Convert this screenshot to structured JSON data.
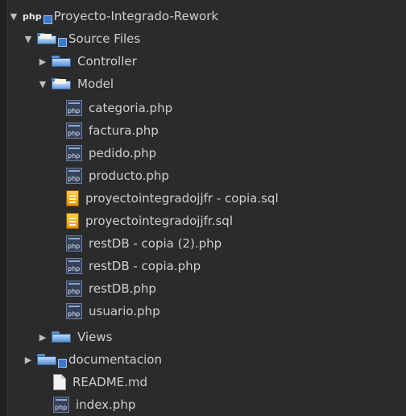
{
  "tree": {
    "project": {
      "name": "Proyecto-Integrado-Rework",
      "icon": "php-project-icon",
      "children": {
        "source_files": {
          "name": "Source Files",
          "icon": "source-folder-icon",
          "folders": {
            "controller": "Controller",
            "model": "Model",
            "views": "Views"
          },
          "model_files": [
            "categoria.php",
            "factura.php",
            "pedido.php",
            "producto.php",
            "proyectointegradojjfr - copia.sql",
            "proyectointegradojjfr.sql",
            "restDB - copia (2).php",
            "restDB - copia.php",
            "restDB.php",
            "usuario.php"
          ]
        },
        "documentacion": "documentacion",
        "readme": "README.md",
        "index": "index.php"
      }
    }
  },
  "colors": {
    "background": "#2b2b2b",
    "text": "#cfcfcf",
    "folder": "#5b8fcf",
    "sql": "#e59200"
  }
}
